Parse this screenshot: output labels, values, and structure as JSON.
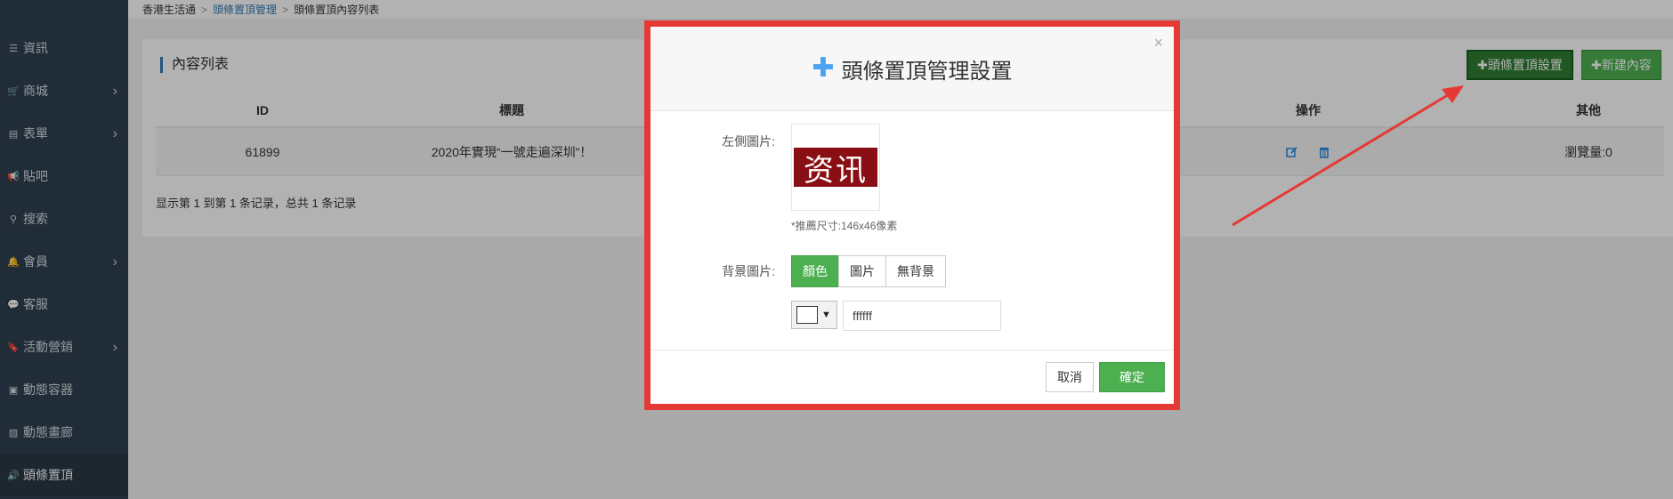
{
  "sidebar": {
    "items": [
      {
        "label": "資訊",
        "icon": "list-icon",
        "chevron": false
      },
      {
        "label": "商城",
        "icon": "cart-icon",
        "chevron": true
      },
      {
        "label": "表單",
        "icon": "form-icon",
        "chevron": true
      },
      {
        "label": "貼吧",
        "icon": "megaphone-icon",
        "chevron": false
      },
      {
        "label": "搜索",
        "icon": "search-icon",
        "chevron": false
      },
      {
        "label": "會員",
        "icon": "bell-icon",
        "chevron": true
      },
      {
        "label": "客服",
        "icon": "chat-icon",
        "chevron": false
      },
      {
        "label": "活動營銷",
        "icon": "bookmark-icon",
        "chevron": true
      },
      {
        "label": "動態容器",
        "icon": "inbox-icon",
        "chevron": false
      },
      {
        "label": "動態畫廊",
        "icon": "image-icon",
        "chevron": false
      },
      {
        "label": "頭條置頂",
        "icon": "volume-icon",
        "chevron": false,
        "active": true
      }
    ]
  },
  "breadcrumb": {
    "home": "香港生活通",
    "section": "頭條置頂管理",
    "current": "頭條置頂內容列表"
  },
  "panel": {
    "title": "內容列表",
    "btn_settings": "✚頭條置頂設置",
    "btn_new": "✚新建內容"
  },
  "table": {
    "headers": {
      "id": "ID",
      "title": "標題",
      "op": "操作",
      "other": "其他"
    },
    "rows": [
      {
        "id": "61899",
        "title": "2020年實現“一號走遍深圳”！",
        "other": "瀏覽量:0"
      }
    ],
    "summary": "显示第 1 到第 1 条记录，总共 1 条记录"
  },
  "modal": {
    "title": "頭條置頂管理設置",
    "close": "×",
    "left_image_label": "左側圖片:",
    "logo_text": "资讯",
    "hint": "*推薦尺寸:146x46像素",
    "bg_label": "背景圖片:",
    "bg_options": [
      "顏色",
      "圖片",
      "無背景"
    ],
    "color_value": "ffffff",
    "caret": "▼",
    "cancel": "取消",
    "confirm": "確定"
  },
  "colors": {
    "accent_green": "#4caf50",
    "highlight_red": "#e53935",
    "sidebar_bg": "#2f4050"
  }
}
